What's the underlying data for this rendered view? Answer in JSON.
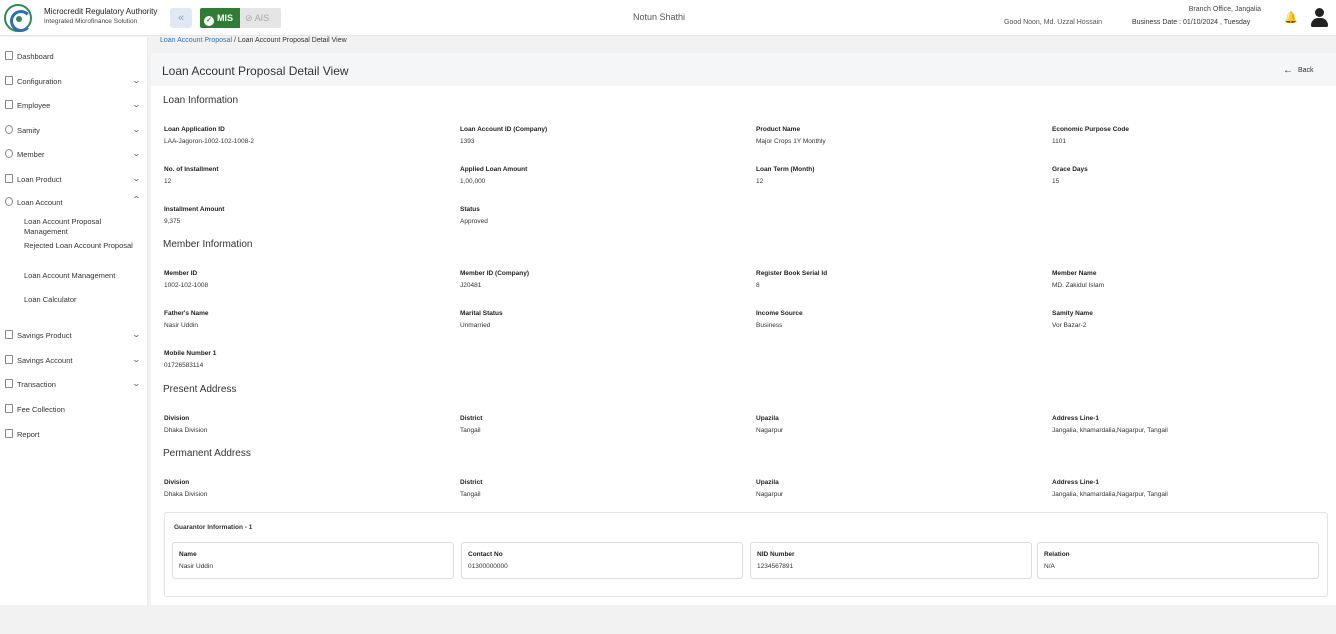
{
  "header": {
    "org_name": "Microcredit Regulatory Authority",
    "org_sub": "Integrated Microfinance Solution",
    "mis_label": "MIS",
    "ais_label": "AIS",
    "app_title": "Notun Shathi",
    "greeting": "Good Noon, Md. Uzzal Hossain",
    "branch": "Branch Office, Jangalia",
    "business_date": "Business Date : 01/10/2024 , Tuesday"
  },
  "sidebar": {
    "items": [
      {
        "label": "Dashboard"
      },
      {
        "label": "Configuration"
      },
      {
        "label": "Employee"
      },
      {
        "label": "Samity"
      },
      {
        "label": "Member"
      },
      {
        "label": "Loan Product"
      },
      {
        "label": "Loan Account"
      },
      {
        "label": "Savings Product"
      },
      {
        "label": "Savings Account"
      },
      {
        "label": "Transaction"
      },
      {
        "label": "Fee Collection"
      },
      {
        "label": "Report"
      }
    ],
    "sub_items": [
      {
        "label": "Loan Account Proposal Management"
      },
      {
        "label": "Rejected Loan Account Proposal"
      },
      {
        "label": "Loan Account Management"
      },
      {
        "label": "Loan Calculator"
      }
    ]
  },
  "breadcrumb": {
    "link": "Loan Account Proposal",
    "current": " / Loan Account Proposal Detail View"
  },
  "page": {
    "title": "Loan Account Proposal Detail View",
    "back_label": "Back"
  },
  "loan_info": {
    "title": "Loan Information",
    "fields": [
      {
        "label": "Loan Application ID",
        "value": "LAA-Jagoron-1002-102-1008-2"
      },
      {
        "label": "Loan Account ID (Company)",
        "value": "1393"
      },
      {
        "label": "Product Name",
        "value": "Major Crops 1Y Monthly"
      },
      {
        "label": "Economic Purpose Code",
        "value": "1101"
      },
      {
        "label": "No. of Installment",
        "value": "12"
      },
      {
        "label": "Applied Loan Amount",
        "value": "1,00,000"
      },
      {
        "label": "Loan Term (Month)",
        "value": "12"
      },
      {
        "label": "Grace Days",
        "value": "15"
      },
      {
        "label": "Installment Amount",
        "value": "9,375"
      },
      {
        "label": "Status",
        "value": "Approved"
      }
    ]
  },
  "member_info": {
    "title": "Member Information",
    "fields": [
      {
        "label": "Member ID",
        "value": "1002-102-1008"
      },
      {
        "label": "Member ID (Company)",
        "value": "J20481"
      },
      {
        "label": "Register Book Serial Id",
        "value": "8"
      },
      {
        "label": "Member Name",
        "value": "MD. Zakidul Islam"
      },
      {
        "label": "Father's Name",
        "value": "Nasir Uddin"
      },
      {
        "label": "Marital Status",
        "value": "Unmarried"
      },
      {
        "label": "Income Source",
        "value": "Business"
      },
      {
        "label": "Samity Name",
        "value": "Vor Bazar-2"
      },
      {
        "label": "Mobile Number 1",
        "value": "01726583114"
      }
    ]
  },
  "present_address": {
    "title": "Present Address",
    "fields": [
      {
        "label": "Division",
        "value": "Dhaka Division"
      },
      {
        "label": "District",
        "value": "Tangail"
      },
      {
        "label": "Upazila",
        "value": "Nagarpur"
      },
      {
        "label": "Address Line-1",
        "value": "Jangalia, khamardalia,Nagarpur, Tangail"
      }
    ]
  },
  "permanent_address": {
    "title": "Permanent Address",
    "fields": [
      {
        "label": "Division",
        "value": "Dhaka Division"
      },
      {
        "label": "District",
        "value": "Tangail"
      },
      {
        "label": "Upazila",
        "value": "Nagarpur"
      },
      {
        "label": "Address Line-1",
        "value": "Jangalia, khamardalia,Nagarpur, Tangail"
      }
    ]
  },
  "guarantor": {
    "title": "Guarantor Information - 1",
    "fields": [
      {
        "label": "Name",
        "value": "Nasir Uddin"
      },
      {
        "label": "Contact No",
        "value": "01300000000"
      },
      {
        "label": "NID Number",
        "value": "1234567891"
      },
      {
        "label": "Relation",
        "value": "N/A"
      }
    ]
  }
}
